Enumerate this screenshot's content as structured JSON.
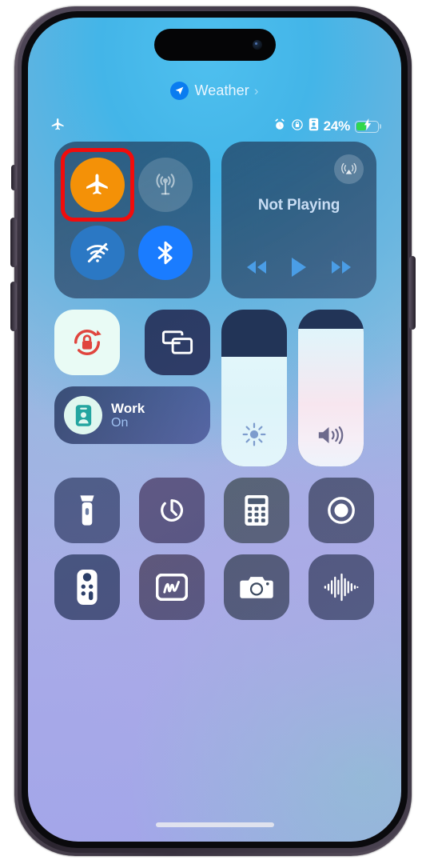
{
  "device": {
    "name": "iphone-14-pro",
    "frame_color": "#4b4250"
  },
  "status_bar": {
    "location_indicator": {
      "label": "Weather",
      "icon": "location-arrow-icon",
      "chevron": "›",
      "badge_color": "#0a7cf0"
    },
    "left_icons": [
      {
        "name": "airplane-mode-icon",
        "label": "Airplane Mode"
      }
    ],
    "right_icons": [
      {
        "name": "alarm-icon",
        "label": "Alarm"
      },
      {
        "name": "rotation-lock-icon",
        "label": "Rotation Lock"
      },
      {
        "name": "focus-icon",
        "label": "Focus"
      }
    ],
    "battery": {
      "percent_label": "24%",
      "percent_value": 24,
      "charging": true,
      "fill_color": "#32d74b"
    }
  },
  "control_center": {
    "connectivity": {
      "module_name": "Connectivity",
      "toggles": [
        {
          "name": "airplane-mode-toggle",
          "label": "Airplane Mode",
          "state": "On",
          "color": "#f49107",
          "highlighted": true
        },
        {
          "name": "cellular-data-toggle",
          "label": "Cellular Data",
          "state": "Off",
          "color": "rgba(255,255,255,0.16)",
          "highlighted": false
        },
        {
          "name": "wifi-toggle",
          "label": "Wi-Fi",
          "state": "Off",
          "color": "#2b78c4",
          "highlighted": false
        },
        {
          "name": "bluetooth-toggle",
          "label": "Bluetooth",
          "state": "On",
          "color": "#1a7cff",
          "highlighted": false
        }
      ]
    },
    "media": {
      "module_name": "Now Playing",
      "title": "Not Playing",
      "airplay_label": "AirPlay",
      "controls": [
        {
          "name": "rewind-button",
          "label": "Rewind"
        },
        {
          "name": "play-button",
          "label": "Play"
        },
        {
          "name": "fast-forward-button",
          "label": "Fast Forward"
        }
      ],
      "control_color": "#4a9de6"
    },
    "tiles": [
      {
        "name": "rotation-lock-tile",
        "label": "Rotation Lock",
        "state": "On",
        "active": true
      },
      {
        "name": "screen-mirroring-tile",
        "label": "Screen Mirroring",
        "state": "Off",
        "active": false
      }
    ],
    "focus": {
      "name": "Work",
      "state": "On",
      "icon": "id-card-icon"
    },
    "sliders": [
      {
        "name": "brightness-slider",
        "label": "Brightness",
        "value": 70,
        "icon": "sun-icon"
      },
      {
        "name": "volume-slider",
        "label": "Volume",
        "value": 88,
        "icon": "speaker-icon"
      }
    ],
    "quick_actions": [
      {
        "name": "flashlight-button",
        "label": "Flashlight"
      },
      {
        "name": "timer-button",
        "label": "Timer"
      },
      {
        "name": "calculator-button",
        "label": "Calculator"
      },
      {
        "name": "screen-record-button",
        "label": "Screen Recording"
      },
      {
        "name": "apple-tv-remote-button",
        "label": "Apple TV Remote"
      },
      {
        "name": "quick-note-button",
        "label": "Quick Note"
      },
      {
        "name": "camera-button",
        "label": "Camera"
      },
      {
        "name": "sound-recognition-button",
        "label": "Sound Recognition"
      }
    ]
  },
  "annotation": {
    "highlight_color": "#f20c0c",
    "target": "airplane-mode-toggle"
  },
  "home_indicator": {
    "label": "Home Indicator"
  }
}
